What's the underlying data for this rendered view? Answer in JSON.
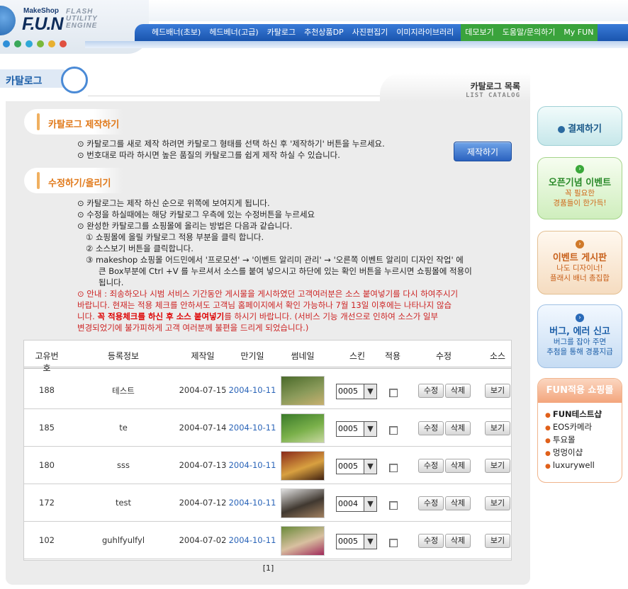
{
  "brand": {
    "small": "MakeShop",
    "big": "F.U.N",
    "tag_lines": [
      "FLASH",
      "UTILITY",
      "ENGINE"
    ]
  },
  "nav": {
    "items": [
      "헤드배너(초보)",
      "헤드베너(고급)",
      "카탈로그",
      "추천상품DP",
      "사진편집기",
      "이미지라이브러리"
    ],
    "highlight_items": [
      "데모보기",
      "도움말/문의하기",
      "My FUN"
    ]
  },
  "dots": [
    "#2f8fd8",
    "#3aa85a",
    "#2fa8d8",
    "#7ab83a",
    "#e8b030",
    "#e05040"
  ],
  "page_title": "카탈로그",
  "list_tab": {
    "title": "카탈로그 목록",
    "sub": "LIST CATALOG"
  },
  "section_make": {
    "label": "카탈로그 제작하기",
    "lines": [
      "⊙ 카탈로그를 새로 제작 하려면 카탈로그 형태를 선택 하신 후 '제작하기' 버튼을 누르세요.",
      "⊙ 번호대로 따라 하시면 높은 품질의 카탈로그를 쉽게 제작 하실 수 있습니다."
    ],
    "button": "제작하기"
  },
  "section_edit": {
    "label": "수정하기/올리기",
    "lines": [
      "⊙ 카탈로그는 제작 하신 순으로 위쪽에 보여지게 됩니다.",
      "⊙ 수정을 하실때에는 해당 카탈로그 우측에 있는 수정버튼을 누르세요",
      "⊙ 완성한 카탈로그를 쇼핑몰에 올리는 방법은 다음과 같습니다.",
      "① 쇼핑몰에 올릴 카탈로그 적용 부분을 클릭 합니다.",
      "② 소스보기 버튼을 클릭합니다.",
      "③ makeshop 쇼핑몰 어드민에서 '프로모션' → '이벤트 알리미 관리' → '오른쪽 이벤트 알리미 디자인 작업' 에",
      "큰 Box부분에 Ctrl +V 를 누르셔서 소스를 붙여 넣으시고 하단에 있는 확인 버튼을 누르시면 쇼핑몰에 적용이",
      "됩니다."
    ],
    "notice_1": "⊙ 안내 : 죄송하오나 시범 서비스 기간동안 게시물을 게시하였던 고객여러분은 소스 붙여넣기를 다시 하여주시기",
    "notice_2": "바랍니다. 현재는 적용 체크를 안하셔도 고객님 홈페이지에서 확인 가능하나 7월 13일 이후에는 나타나지 않습",
    "notice_3a": "니다. ",
    "notice_3b": "꼭 적용체크를 하신 후 소스 붙여넣기",
    "notice_3c": "를 하시기 바랍니다. (서비스 기능 개선으로 인하여 소스가 일부",
    "notice_4": "변경되었기에 불가피하게 고객 여러분께 불편을 드리게 되었습니다.)"
  },
  "table": {
    "headers": [
      "고유번호",
      "등록정보",
      "제작일",
      "만기일",
      "썸네일",
      "스킨",
      "적용",
      "수정",
      "소스"
    ],
    "rows": [
      {
        "id": "188",
        "name": "테스트",
        "made": "2004-07-15",
        "expire": "2004-10-11",
        "skin": "0005",
        "thumb": [
          "#4a6a2a",
          "#8a9a5a",
          "#c8b070"
        ]
      },
      {
        "id": "185",
        "name": "te",
        "made": "2004-07-14",
        "expire": "2004-10-11",
        "skin": "0005",
        "thumb": [
          "#3a7a2a",
          "#7ab04a",
          "#c8d8a0"
        ]
      },
      {
        "id": "180",
        "name": "sss",
        "made": "2004-07-13",
        "expire": "2004-10-11",
        "skin": "0005",
        "thumb": [
          "#8a2a1a",
          "#d8a040",
          "#402010"
        ]
      },
      {
        "id": "172",
        "name": "test",
        "made": "2004-07-12",
        "expire": "2004-10-11",
        "skin": "0004",
        "thumb": [
          "#e0e0e0",
          "#403830",
          "#a08060"
        ]
      },
      {
        "id": "102",
        "name": "guhlfyulfyl",
        "made": "2004-07-02",
        "expire": "2004-10-11",
        "skin": "0005",
        "thumb": [
          "#6a8a3a",
          "#d8c0a0",
          "#a02a5a"
        ]
      }
    ],
    "edit_label": "수정",
    "delete_label": "삭제",
    "view_label": "보기",
    "pager": "[1]"
  },
  "sidebar": {
    "pay": {
      "title": "결제하기"
    },
    "open": {
      "title": "오픈기념 이벤트",
      "sub1": "꼭 필요한",
      "sub2": "경품들이 한가득!"
    },
    "event": {
      "title": "이벤트 게시판",
      "sub1": "나도 디자이너!",
      "sub2": "플래시 배너 총집합"
    },
    "bug": {
      "title": "버그, 에러 신고",
      "sub1": "버그를 잡아 주면",
      "sub2": "추첨을 통해 경품지급"
    },
    "shop": {
      "title": "FUN적용 쇼핑몰",
      "items": [
        "FUN테스트샵",
        "EOS카메라",
        "투요몰",
        "멍멍이샵",
        "luxurywell"
      ]
    }
  }
}
